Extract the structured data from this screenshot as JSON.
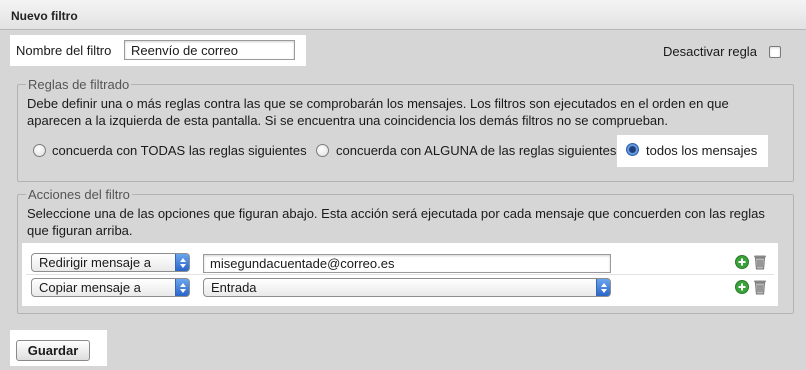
{
  "panel": {
    "title": "Nuevo filtro"
  },
  "filter_name": {
    "label": "Nombre del filtro",
    "value": "Reenvío de correo"
  },
  "disable_rule": {
    "label": "Desactivar regla",
    "checked": false
  },
  "rules": {
    "legend": "Reglas de filtrado",
    "description_line1": "Debe definir una o más reglas contra las que se comprobarán los mensajes. Los filtros son ejecutados en el orden en que",
    "description_line2": "aparecen a la izquierda de esta pantalla. Si se encuentra una coincidencia los demás filtros no se comprueban.",
    "options": [
      {
        "label": "concuerda con TODAS las reglas siguientes",
        "checked": false
      },
      {
        "label": "concuerda con ALGUNA de las reglas siguientes",
        "checked": false
      },
      {
        "label": "todos los mensajes",
        "checked": true
      }
    ]
  },
  "actions": {
    "legend": "Acciones del filtro",
    "description_line1": "Seleccione una de las opciones que figuran abajo. Esta acción será ejecutada por cada mensaje que concuerden con las reglas",
    "description_line2": "que figuran arriba.",
    "rows": [
      {
        "action": "Redirigir mensaje a",
        "target": "misegundacuentade@correo.es",
        "target_type": "text"
      },
      {
        "action": "Copiar mensaje a",
        "target": "Entrada",
        "target_type": "select"
      }
    ]
  },
  "save_button": "Guardar",
  "icons": {
    "add": "plus-circle-icon",
    "delete": "trash-icon"
  },
  "colors": {
    "accent_blue": "#2f6fcc",
    "add_green": "#3aa23a"
  }
}
